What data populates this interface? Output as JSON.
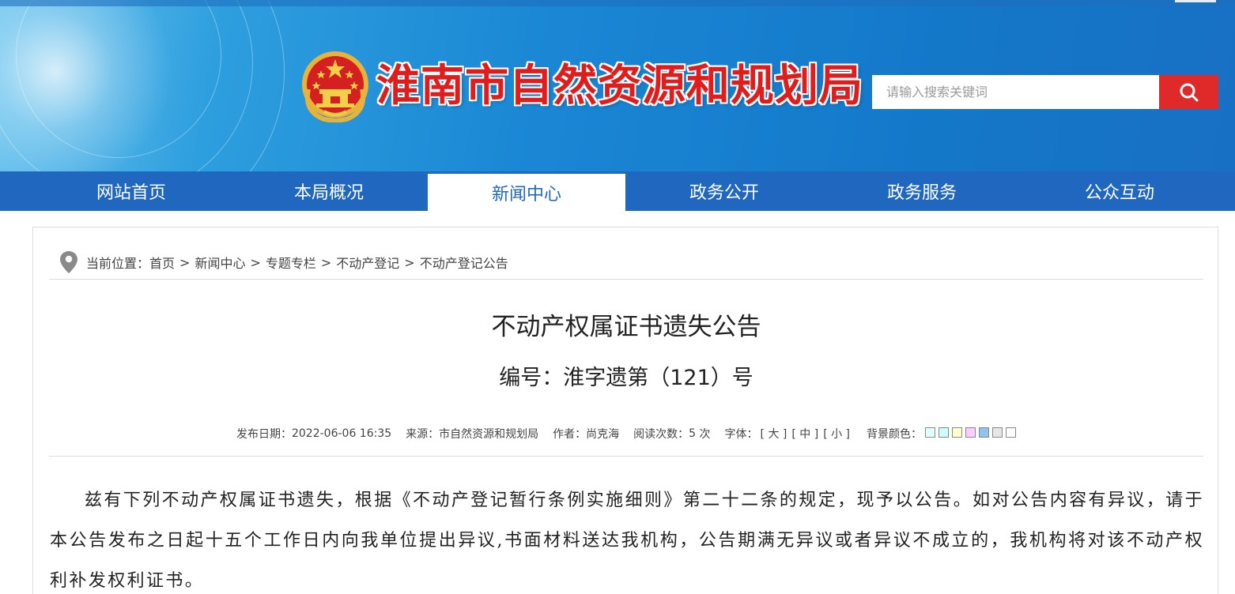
{
  "header": {
    "site_title": "淮南市自然资源和规划局",
    "emblem_icon": "national-emblem-icon",
    "search": {
      "placeholder": "请输入搜索关键词",
      "button_icon": "search-icon",
      "button_color": "#e02a2a"
    }
  },
  "nav": {
    "items": [
      {
        "label": "网站首页",
        "active": false
      },
      {
        "label": "本局概况",
        "active": false
      },
      {
        "label": "新闻中心",
        "active": true
      },
      {
        "label": "政务公开",
        "active": false
      },
      {
        "label": "政务服务",
        "active": false
      },
      {
        "label": "公众互动",
        "active": false
      }
    ],
    "color": "#1f67bf"
  },
  "breadcrumb": {
    "icon": "location-pin-icon",
    "prefix": "当前位置：",
    "items": [
      "首页",
      "新闻中心",
      "专题专栏",
      "不动产登记",
      "不动产登记公告"
    ],
    "separator": ">"
  },
  "article": {
    "title": "不动产权属证书遗失公告",
    "number": "编号：淮字遗第（121）号",
    "meta": {
      "date_label": "发布日期：",
      "date": "2022-06-06 16:35",
      "source_label": "来源：",
      "source": "市自然资源和规划局",
      "author_label": "作者：",
      "author": "尚克海",
      "views_label": "阅读次数：",
      "views": "5",
      "views_unit": "次",
      "font_label": "字体：",
      "font_large": "[ 大 ]",
      "font_medium": "[ 中 ]",
      "font_small": "[ 小 ]",
      "bg_label": "背景颜色：",
      "bg_colors": [
        "#e1ffff",
        "#ccfffe",
        "#ffffcc",
        "#ffccff",
        "#8ec3f2",
        "#e6e6e6",
        "#ffffff"
      ]
    },
    "body": "兹有下列不动产权属证书遗失，根据《不动产登记暂行条例实施细则》第二十二条的规定，现予以公告。如对公告内容有异议，请于本公告发布之日起十五个工作日内向我单位提出异议,书面材料送达我机构，公告期满无异议或者异议不成立的，我机构将对该不动产权利补发权利证书。"
  }
}
